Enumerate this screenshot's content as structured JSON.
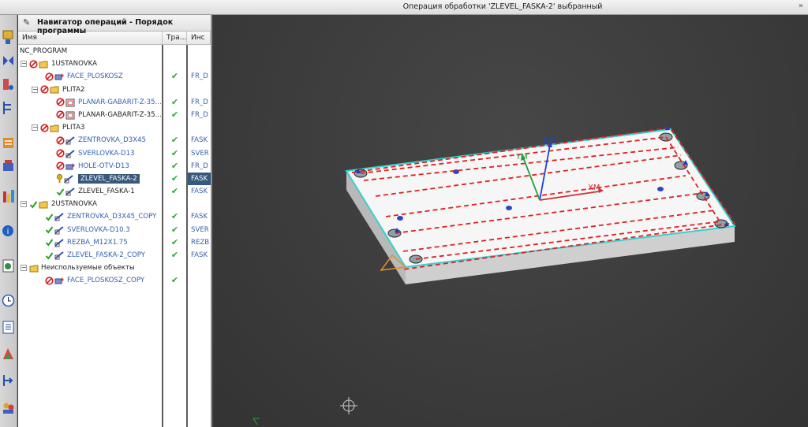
{
  "window": {
    "title": "Операция обработки 'ZLEVEL_FASKA-2' выбранный",
    "overflow_icon": "double-chevron-icon"
  },
  "navigator": {
    "title": "Навигатор операций - Порядок программы",
    "columns": {
      "name": "Имя",
      "path": "Тра...",
      "tool": "Инс"
    },
    "rows": [
      {
        "label": "NC_PROGRAM",
        "path": "",
        "tool": ""
      },
      {
        "label": "1USTANOVKA",
        "path": "",
        "tool": ""
      },
      {
        "label": "FACE_PLOSKOSZ",
        "path": "✔",
        "tool": "FR_D"
      },
      {
        "label": "PLITA2",
        "path": "",
        "tool": ""
      },
      {
        "label": "PLANAR-GABARIT-Z-35....",
        "path": "✔",
        "tool": "FR_D"
      },
      {
        "label": "PLANAR-GABARIT-Z-35....",
        "path": "✔",
        "tool": "FR_D"
      },
      {
        "label": "PLITA3",
        "path": "",
        "tool": ""
      },
      {
        "label": "ZENTROVKA_D3X45",
        "path": "✔",
        "tool": "FASK"
      },
      {
        "label": "SVERLOVKA-D13",
        "path": "✔",
        "tool": "SVER"
      },
      {
        "label": "HOLE-OTV-D13",
        "path": "✔",
        "tool": "FR_D"
      },
      {
        "label": "ZLEVEL_FASKA-2",
        "path": "✔",
        "tool": "FASK"
      },
      {
        "label": "ZLEVEL_FASKA-1",
        "path": "✔",
        "tool": "FASK"
      },
      {
        "label": "2USTANOVKA",
        "path": "",
        "tool": ""
      },
      {
        "label": "ZENTROVKA_D3X45_COPY",
        "path": "✔",
        "tool": "FASK"
      },
      {
        "label": "SVERLOVKA-D10.3",
        "path": "✔",
        "tool": "SVER"
      },
      {
        "label": "REZBA_M12X1.75",
        "path": "✔",
        "tool": "REZB"
      },
      {
        "label": "ZLEVEL_FASKA-2_COPY",
        "path": "✔",
        "tool": "FASK"
      },
      {
        "label": "Неиспользуемые объекты",
        "path": "",
        "tool": ""
      },
      {
        "label": "FACE_PLOSKOSZ_COPY",
        "path": "✔",
        "tool": ""
      }
    ]
  },
  "viewport": {
    "axes": {
      "x": "XM",
      "y": "YM",
      "z": "ZM"
    },
    "colors": {
      "toolpath": "#e02020",
      "edge": "#36d0d0",
      "x_axis": "#d03030",
      "y_axis": "#2aa040",
      "z_axis": "#2040d0"
    }
  },
  "resource_bar": {
    "icons": [
      "machine-tool-icon",
      "geometry-icon",
      "tool-icon",
      "method-icon",
      "program-order-icon",
      "feed-icon",
      "history-icon",
      "roles-icon",
      "system-icon",
      "clock-icon",
      "info-list-icon",
      "palette-icon",
      "process-icon",
      "user-roles-icon"
    ]
  },
  "colors": {
    "selection": "#39587d",
    "check": "#2aa82a",
    "link_text": "#3360b0"
  }
}
